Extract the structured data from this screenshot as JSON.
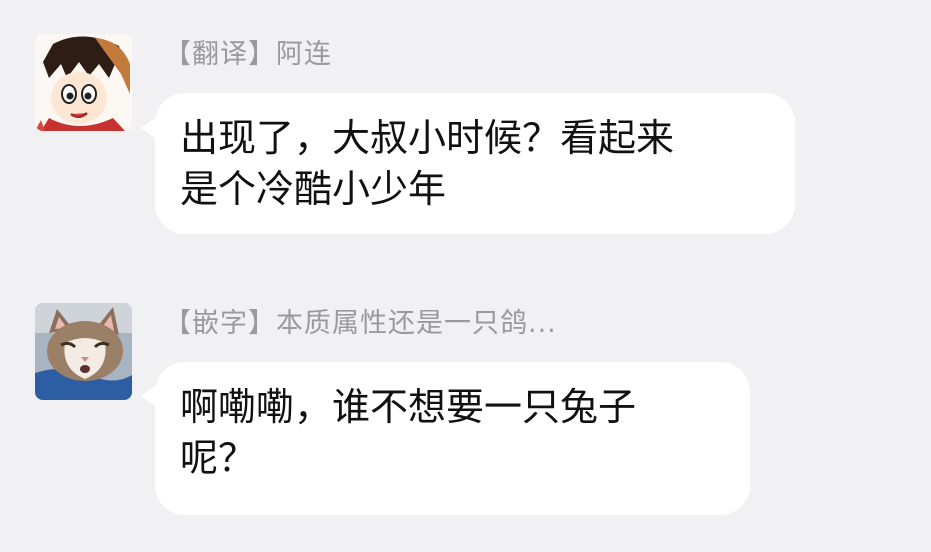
{
  "conversation": {
    "messages": [
      {
        "sender": "【翻译】阿连",
        "avatar_icon": "anime-boy-avatar-icon",
        "text_lines": [
          "出现了，大叔小时候？看起来",
          "是个冷酷小少年"
        ]
      },
      {
        "sender": "【嵌字】本质属性还是一只鸽...",
        "avatar_icon": "cat-avatar-icon",
        "text_lines": [
          "啊嘞嘞，谁不想要一只兔子",
          "呢？"
        ]
      }
    ]
  },
  "colors": {
    "background": "#f1f1f3",
    "bubble": "#ffffff",
    "sender_text": "#9a9a9e",
    "message_text": "#111111"
  }
}
